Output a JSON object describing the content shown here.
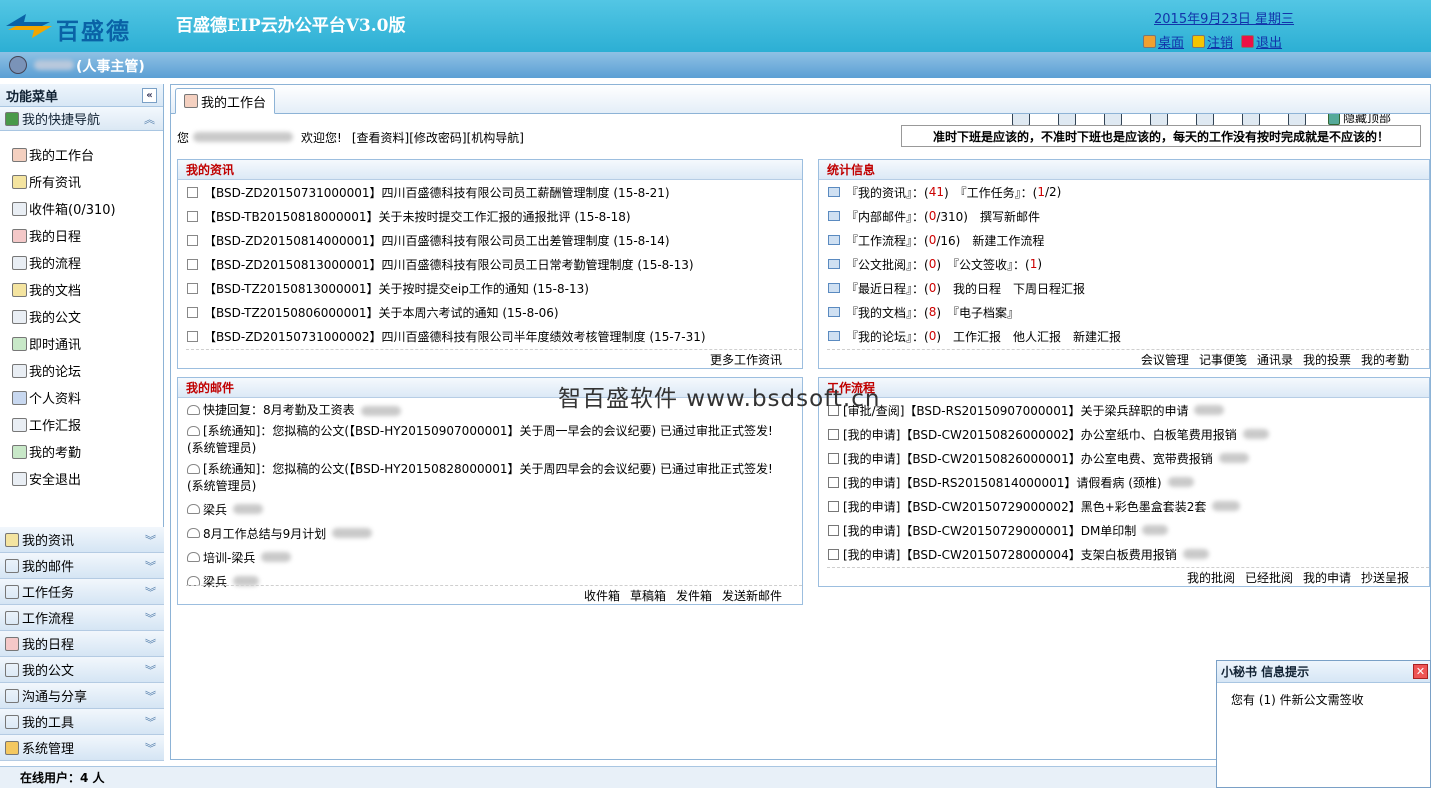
{
  "header": {
    "logo_text": "百盛德",
    "app_title": "百盛德EIP云办公平台V3.0版",
    "date": "2015年9月23日 星期三",
    "links": [
      {
        "label": "桌面",
        "icon": "desktop-icon"
      },
      {
        "label": "注销",
        "icon": "logout-icon"
      },
      {
        "label": "退出",
        "icon": "exit-icon"
      }
    ]
  },
  "userbar": {
    "role": "(人事主管)",
    "toolbar_icons": [
      "notepad-icon",
      "home-icon",
      "clipboard-icon",
      "mail-icon",
      "contacts-icon",
      "calendar-icon",
      "user-card-icon"
    ],
    "hide_top": "隐藏顶部"
  },
  "sidebar": {
    "menu_title": "功能菜单",
    "collapse_glyph": "«",
    "quick_nav": "我的快捷导航",
    "quick_items": [
      {
        "label": "我的工作台",
        "icon": "home-icon"
      },
      {
        "label": "所有资讯",
        "icon": "news-icon"
      },
      {
        "label": "收件箱(0/310)",
        "icon": "inbox-icon"
      },
      {
        "label": "我的日程",
        "icon": "calendar-icon"
      },
      {
        "label": "我的流程",
        "icon": "flow-icon"
      },
      {
        "label": "我的文档",
        "icon": "document-icon"
      },
      {
        "label": "我的公文",
        "icon": "official-doc-icon"
      },
      {
        "label": "即时通讯",
        "icon": "chat-icon"
      },
      {
        "label": "我的论坛",
        "icon": "forum-icon"
      },
      {
        "label": "个人资料",
        "icon": "user-icon"
      },
      {
        "label": "工作汇报",
        "icon": "report-icon"
      },
      {
        "label": "我的考勤",
        "icon": "attendance-icon"
      },
      {
        "label": "安全退出",
        "icon": "exit-icon"
      }
    ],
    "groups": [
      {
        "label": "我的资讯",
        "icon": "news-icon"
      },
      {
        "label": "我的邮件",
        "icon": "mail-icon"
      },
      {
        "label": "工作任务",
        "icon": "task-icon"
      },
      {
        "label": "工作流程",
        "icon": "flow-icon"
      },
      {
        "label": "我的日程",
        "icon": "calendar-icon"
      },
      {
        "label": "我的公文",
        "icon": "official-doc-icon"
      },
      {
        "label": "沟通与分享",
        "icon": "share-icon"
      },
      {
        "label": "我的工具",
        "icon": "tool-icon"
      },
      {
        "label": "系统管理",
        "icon": "settings-icon"
      }
    ]
  },
  "tab": {
    "label": "我的工作台"
  },
  "welcome": {
    "prefix": "您",
    "greet": "欢迎您!",
    "links": [
      "[查看资料]",
      "[修改密码]",
      "[机构导航]"
    ],
    "motto": "准时下班是应该的，不准时下班也是应该的，每天的工作没有按时完成就是不应该的！"
  },
  "news": {
    "title": "我的资讯",
    "items": [
      "【BSD-ZD20150731000001】四川百盛德科技有限公司员工薪酬管理制度 (15-8-21)",
      "【BSD-TB20150818000001】关于未按时提交工作汇报的通报批评 (15-8-18)",
      "【BSD-ZD20150814000001】四川百盛德科技有限公司员工出差管理制度 (15-8-14)",
      "【BSD-ZD20150813000001】四川百盛德科技有限公司员工日常考勤管理制度 (15-8-13)",
      "【BSD-TZ20150813000001】关于按时提交eip工作的通知 (15-8-13)",
      "【BSD-TZ20150806000001】关于本周六考试的通知 (15-8-06)",
      "【BSD-ZD20150731000002】四川百盛德科技有限公司半年度绩效考核管理制度 (15-7-31)"
    ],
    "more": "更多工作资讯"
  },
  "stats": {
    "title": "统计信息",
    "rows": [
      [
        {
          "t": "『我的资讯』：("
        },
        {
          "t": "41",
          "r": true
        },
        {
          "t": ")　『工作任务』：("
        },
        {
          "t": "1",
          "r": true
        },
        {
          "t": "/2)"
        }
      ],
      [
        {
          "t": "『内部邮件』：("
        },
        {
          "t": "0",
          "r": true
        },
        {
          "t": "/310)　撰写新邮件"
        }
      ],
      [
        {
          "t": "『工作流程』：("
        },
        {
          "t": "0",
          "r": true
        },
        {
          "t": "/16)　新建工作流程"
        }
      ],
      [
        {
          "t": "『公文批阅』：("
        },
        {
          "t": "0",
          "r": true
        },
        {
          "t": ")　『公文签收』：("
        },
        {
          "t": "1",
          "r": true
        },
        {
          "t": ")"
        }
      ],
      [
        {
          "t": "『最近日程』：("
        },
        {
          "t": "0",
          "r": true
        },
        {
          "t": ")　我的日程　下周日程汇报"
        }
      ],
      [
        {
          "t": "『我的文档』：("
        },
        {
          "t": "8",
          "r": true
        },
        {
          "t": ")　『电子档案』"
        }
      ],
      [
        {
          "t": "『我的论坛』：("
        },
        {
          "t": "0",
          "r": true
        },
        {
          "t": ")　工作汇报　他人汇报　新建汇报"
        }
      ]
    ],
    "footer": [
      "会议管理",
      "记事便笺",
      "通讯录",
      "我的投票",
      "我的考勤"
    ]
  },
  "mail": {
    "title": "我的邮件",
    "items": [
      "快捷回复：8月考勤及工资表",
      "[系统通知]：您拟稿的公文(【BSD-HY20150907000001】关于周一早会的会议纪要) 已通过审批正式签发! (系统管理员)",
      "[系统通知]：您拟稿的公文(【BSD-HY20150828000001】关于周四早会的会议纪要) 已通过审批正式签发! (系统管理员)",
      "梁兵",
      "8月工作总结与9月计划",
      "培训-梁兵",
      "梁兵"
    ],
    "footer": [
      "收件箱",
      "草稿箱",
      "发件箱",
      "发送新邮件"
    ]
  },
  "workflow": {
    "title": "工作流程",
    "items": [
      "[审批/查阅]【BSD-RS20150907000001】关于梁兵辞职的申请",
      "[我的申请]【BSD-CW20150826000002】办公室纸巾、白板笔费用报销",
      "[我的申请]【BSD-CW20150826000001】办公室电费、宽带费报销",
      "[我的申请]【BSD-RS20150814000001】请假看病 (颈椎)",
      "[我的申请]【BSD-CW20150729000002】黑色+彩色墨盒套装2套",
      "[我的申请]【BSD-CW20150729000001】DM单印制",
      "[我的申请]【BSD-CW20150728000004】支架白板费用报销"
    ],
    "footer": [
      "我的批阅",
      "已经批阅",
      "我的申请",
      "抄送呈报"
    ]
  },
  "watermark": "智百盛软件 www.bsdsoft.cn",
  "notify": {
    "title": "小秘书 信息提示",
    "close": "✕",
    "message": "您有 (1) 件新公文需签收"
  },
  "status": {
    "online": "在线用户：4 人"
  },
  "colors": {
    "header": "#2cafd4",
    "accent_red": "#cc0000",
    "link": "#1234aa"
  }
}
